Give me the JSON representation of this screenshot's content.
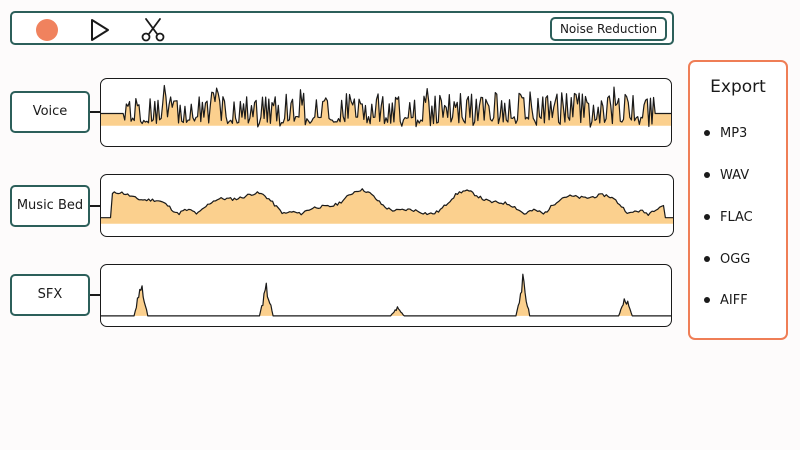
{
  "toolbar": {
    "record_icon": "record-icon",
    "play_icon": "play-icon",
    "cut_icon": "scissors-icon",
    "noise_reduction_label": "Noise Reduction"
  },
  "tracks": [
    {
      "label": "Voice",
      "waveform": "dense speech"
    },
    {
      "label": "Music Bed",
      "waveform": "rolling hills"
    },
    {
      "label": "SFX",
      "waveform": "sparse spikes"
    }
  ],
  "export": {
    "title": "Export",
    "formats": [
      "MP3",
      "WAV",
      "FLAC",
      "OGG",
      "AIFF"
    ]
  },
  "colors": {
    "accent": "#2c5f5a",
    "record": "#f0825e",
    "export_border": "#ef7e56",
    "wave_fill": "#fbd08e",
    "wave_line": "#1a1a1a"
  }
}
